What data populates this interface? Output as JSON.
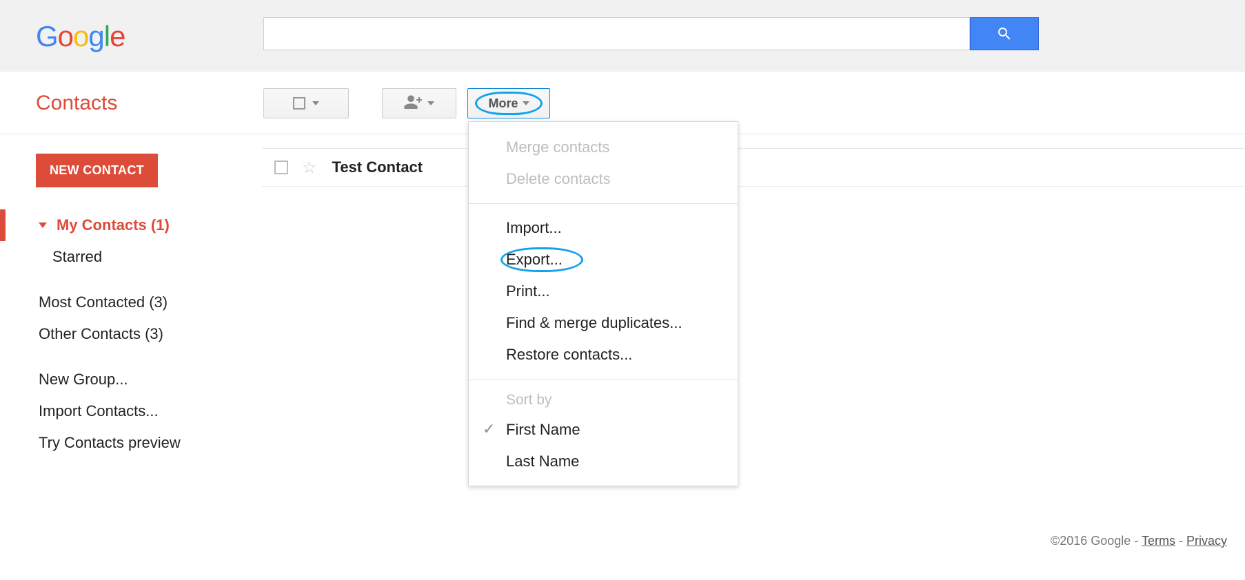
{
  "header": {
    "logo_parts": [
      "G",
      "o",
      "o",
      "g",
      "l",
      "e"
    ],
    "search_value": "",
    "search_placeholder": ""
  },
  "toolbar": {
    "more_label": "More"
  },
  "app_title": "Contacts",
  "sidebar": {
    "new_contact_label": "NEW CONTACT",
    "nav": {
      "my_contacts": "My Contacts (1)",
      "starred": "Starred",
      "most_contacted": "Most Contacted (3)",
      "other_contacts": "Other Contacts (3)",
      "new_group": "New Group...",
      "import": "Import Contacts...",
      "try_preview": "Try Contacts preview"
    }
  },
  "contacts": [
    {
      "name": "Test Contact"
    }
  ],
  "menu": {
    "merge": "Merge contacts",
    "delete": "Delete contacts",
    "import": "Import...",
    "export": "Export...",
    "print": "Print...",
    "find_merge": "Find & merge duplicates...",
    "restore": "Restore contacts...",
    "sort_by": "Sort by",
    "first_name": "First Name",
    "last_name": "Last Name"
  },
  "footer": {
    "copyright": "©2016 Google",
    "sep": " - ",
    "terms": "Terms",
    "privacy": "Privacy"
  }
}
